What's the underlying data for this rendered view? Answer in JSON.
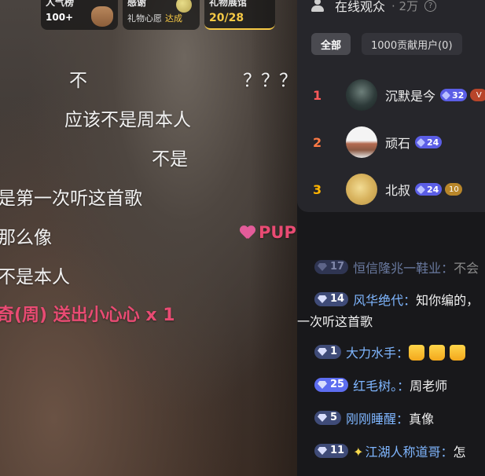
{
  "top_cards": {
    "popularity": {
      "title": "人气榜",
      "value": "100+"
    },
    "thanks": {
      "title": "感谢",
      "subtitle": "礼物心愿",
      "status": "达成"
    },
    "gift_hall": {
      "title": "礼物展馆",
      "progress": "20/28"
    }
  },
  "danmaku": [
    {
      "text": "不"
    },
    {
      "text": "？？？"
    },
    {
      "text": "应该不是周本人"
    },
    {
      "text": "不是"
    },
    {
      "text": "是第一次听这首歌"
    },
    {
      "text": "那么像"
    },
    {
      "text": "PUP"
    },
    {
      "text": "不是本人"
    },
    {
      "text": "奇(周) 送出小心心 x 1"
    }
  ],
  "audience": {
    "title": "在线观众",
    "count": "· 2万",
    "tabs": [
      "全部",
      "1000贡献用户(0)"
    ],
    "ranks": [
      {
        "rank": "1",
        "name": "沉默是今",
        "level": "32",
        "rank_color": "#ff5a5a"
      },
      {
        "rank": "2",
        "name": "顽石",
        "level": "24",
        "rank_color": "#ff7a45"
      },
      {
        "rank": "3",
        "name": "北叔",
        "level": "24",
        "rank_color": "#ffb400",
        "fan_badge": "10"
      }
    ]
  },
  "chat": [
    {
      "level": "17",
      "user": "恒信隆兆一鞋业：",
      "message": "不会",
      "faded": true
    },
    {
      "level": "14",
      "user": "风华绝代：",
      "message": "知你编的，",
      "message_wrap": "一次听这首歌"
    },
    {
      "level": "1",
      "user": "大力水手：",
      "message": ""
    },
    {
      "level": "25",
      "user": "红毛树。：",
      "message": "周老师"
    },
    {
      "level": "5",
      "user": "刚刚睡醒：",
      "message": "真像"
    },
    {
      "level": "11",
      "user": "江湖人称道哥：",
      "message": "怎"
    }
  ]
}
